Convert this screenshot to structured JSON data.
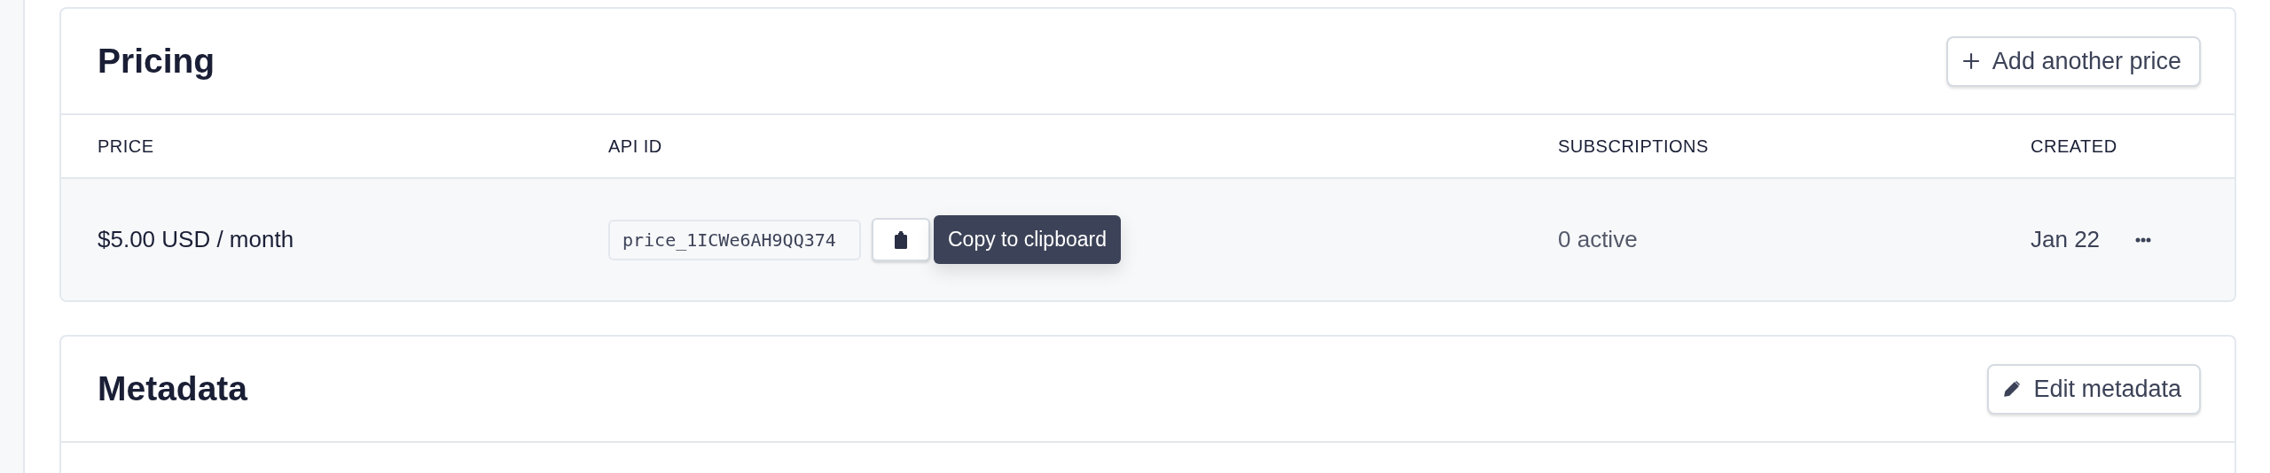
{
  "pricing": {
    "title": "Pricing",
    "add_button": {
      "label": "Add another price"
    },
    "columns": [
      "PRICE",
      "API ID",
      "SUBSCRIPTIONS",
      "CREATED"
    ],
    "rows": [
      {
        "price": "$5.00 USD / month",
        "api_id": "price_1ICWe6AH9QQ374",
        "subscriptions": "0 active",
        "created": "Jan 22"
      }
    ],
    "tooltip": "Copy to clipboard"
  },
  "metadata": {
    "title": "Metadata",
    "edit_button": {
      "label": "Edit metadata"
    }
  }
}
